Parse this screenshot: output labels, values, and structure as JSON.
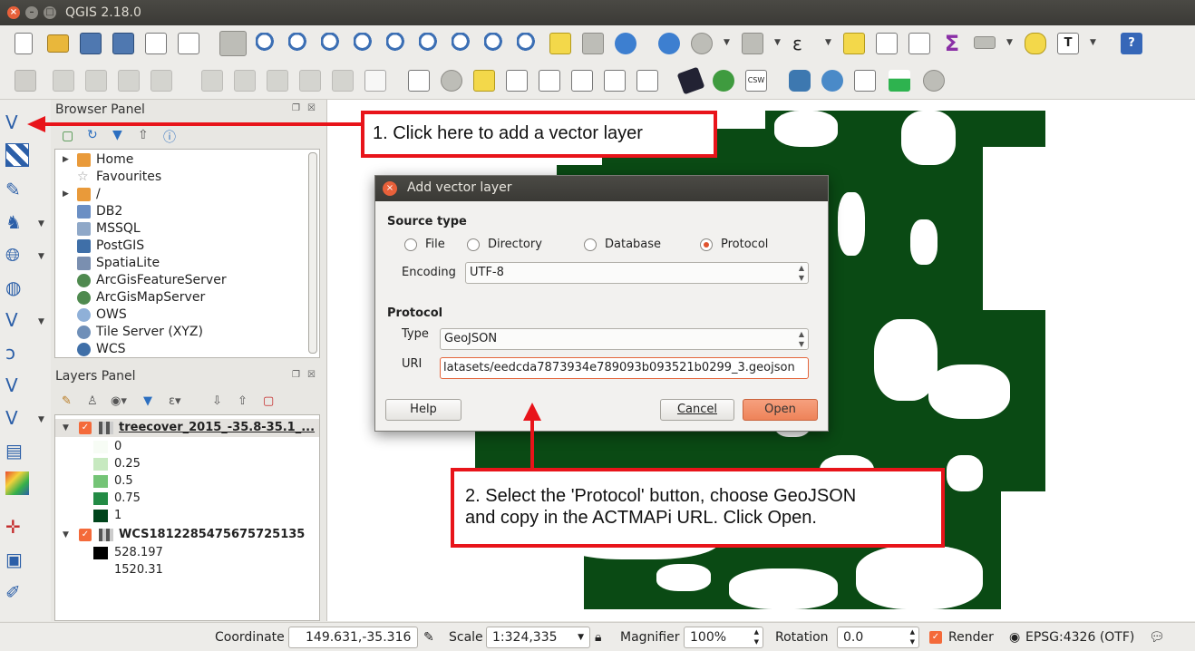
{
  "window": {
    "title": "QGIS 2.18.0"
  },
  "browser_panel": {
    "title": "Browser Panel",
    "items": [
      {
        "label": "Home",
        "arrow": "▶",
        "icon_color": "#e99a3a"
      },
      {
        "label": "Favourites",
        "arrow": "",
        "icon_color": "#ffffff"
      },
      {
        "label": "/",
        "arrow": "▶",
        "icon_color": "#e99a3a"
      },
      {
        "label": "DB2",
        "arrow": "",
        "icon_color": "#6b8fc4"
      },
      {
        "label": "MSSQL",
        "arrow": "",
        "icon_color": "#8fa8c8"
      },
      {
        "label": "PostGIS",
        "arrow": "",
        "icon_color": "#3f6fa8"
      },
      {
        "label": "SpatiaLite",
        "arrow": "",
        "icon_color": "#7a8fb0"
      },
      {
        "label": "ArcGisFeatureServer",
        "arrow": "",
        "icon_color": "#4f8a4f"
      },
      {
        "label": "ArcGisMapServer",
        "arrow": "",
        "icon_color": "#4f8a4f"
      },
      {
        "label": "OWS",
        "arrow": "",
        "icon_color": "#8fb0d8"
      },
      {
        "label": "Tile Server (XYZ)",
        "arrow": "",
        "icon_color": "#6f8fb8"
      },
      {
        "label": "WCS",
        "arrow": "",
        "icon_color": "#3f6fa8"
      }
    ]
  },
  "layers_panel": {
    "title": "Layers Panel",
    "layers": [
      {
        "name": "treecover_2015_-35.8-35.1_...",
        "legend": [
          {
            "label": "0",
            "color": "#f7fcf5"
          },
          {
            "label": "0.25",
            "color": "#c7e9c0"
          },
          {
            "label": "0.5",
            "color": "#74c476"
          },
          {
            "label": "0.75",
            "color": "#238b45"
          },
          {
            "label": "1",
            "color": "#00441b"
          }
        ]
      },
      {
        "name": "WCS1812285475675725135",
        "legend": [
          {
            "label": "528.197",
            "color": "#000000"
          },
          {
            "label": "1520.31",
            "color": "#ffffff"
          }
        ]
      }
    ]
  },
  "dialog": {
    "title": "Add vector layer",
    "source_type_label": "Source type",
    "source_types": [
      {
        "label": "File",
        "selected": false
      },
      {
        "label": "Directory",
        "selected": false
      },
      {
        "label": "Database",
        "selected": false
      },
      {
        "label": "Protocol",
        "selected": true
      }
    ],
    "encoding_label": "Encoding",
    "encoding_value": "UTF-8",
    "protocol_label": "Protocol",
    "type_label": "Type",
    "type_value": "GeoJSON",
    "uri_label": "URI",
    "uri_value": "latasets/eedcda7873934e789093b093521b0299_3.geojson",
    "help_button": "Help",
    "cancel_button": "Cancel",
    "open_button": "Open"
  },
  "callouts": {
    "step1": "1. Click here to add a vector layer",
    "step2_line1": "2. Select the 'Protocol' button, choose GeoJSON",
    "step2_line2": "and copy in the ACTMAPi URL. Click Open."
  },
  "statusbar": {
    "coordinate_label": "Coordinate",
    "coordinate_value": "149.631,-35.316",
    "scale_label": "Scale",
    "scale_value": "1:324,335",
    "magnifier_label": "Magnifier",
    "magnifier_value": "100%",
    "rotation_label": "Rotation",
    "rotation_value": "0.0",
    "render_label": "Render",
    "crs_label": "EPSG:4326 (OTF)"
  },
  "colors": {
    "accent": "#f46a3a",
    "callout_red": "#e8141a",
    "map_green": "#0a4a14"
  }
}
